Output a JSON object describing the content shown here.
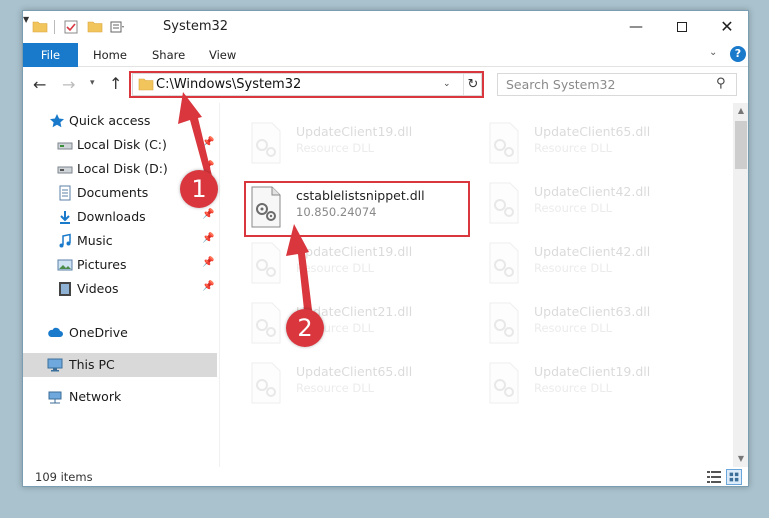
{
  "window": {
    "title": "System32",
    "minimize_label": "—",
    "close_label": "✕"
  },
  "ribbon": {
    "tabs": [
      "File",
      "Home",
      "Share",
      "View"
    ],
    "help_label": "?",
    "collapse_label": "⌄"
  },
  "navigation": {
    "back_glyph": "←",
    "forward_glyph": "→",
    "recent_glyph": "▾",
    "up_glyph": "↑"
  },
  "address": {
    "path": "C:\\Windows\\System32",
    "dropdown_glyph": "⌄",
    "refresh_glyph": "↻"
  },
  "search": {
    "placeholder": "Search System32",
    "icon_glyph": "⚲"
  },
  "nav_pane": {
    "items": [
      {
        "label": "Quick access",
        "icon": "star-icon"
      },
      {
        "label": "Local Disk (C:)",
        "icon": "drive-icon",
        "pinned": true
      },
      {
        "label": "Local Disk (D:)",
        "icon": "drive-icon",
        "pinned": true
      },
      {
        "label": "Documents",
        "icon": "documents-icon",
        "pinned": true
      },
      {
        "label": "Downloads",
        "icon": "downloads-icon",
        "pinned": true
      },
      {
        "label": "Music",
        "icon": "music-icon",
        "pinned": true
      },
      {
        "label": "Pictures",
        "icon": "pictures-icon",
        "pinned": true
      },
      {
        "label": "Videos",
        "icon": "videos-icon",
        "pinned": true
      },
      {
        "label": "OneDrive",
        "icon": "cloud-icon"
      },
      {
        "label": "This PC",
        "icon": "computer-icon",
        "selected": true
      },
      {
        "label": "Network",
        "icon": "network-icon"
      }
    ],
    "pin_glyph": "📌"
  },
  "files": {
    "left": [
      {
        "name": "UpdateClient19.dll",
        "type": "Resource DLL",
        "faded": true
      },
      {
        "name": "cstablelistsnippet.dll",
        "type": "10.850.24074",
        "faded": false
      },
      {
        "name": "UpdateClient19.dll",
        "type": "Resource DLL",
        "faded": true
      },
      {
        "name": "UpdateClient21.dll",
        "type": "Resource DLL",
        "faded": true
      },
      {
        "name": "UpdateClient65.dll",
        "type": "Resource DLL",
        "faded": true
      }
    ],
    "right": [
      {
        "name": "UpdateClient65.dll",
        "type": "Resource DLL",
        "faded": true
      },
      {
        "name": "UpdateClient42.dll",
        "type": "Resource DLL",
        "faded": true
      },
      {
        "name": "UpdateClient42.dll",
        "type": "Resource DLL",
        "faded": true
      },
      {
        "name": "UpdateClient63.dll",
        "type": "Resource DLL",
        "faded": true
      },
      {
        "name": "UpdateClient19.dll",
        "type": "Resource DLL",
        "faded": true
      }
    ]
  },
  "status": {
    "item_count": "109 items"
  },
  "annotations": {
    "step1": "1",
    "step2": "2",
    "color": "#d9363e"
  },
  "colors": {
    "accent": "#1979ca",
    "highlight": "#d9363e",
    "folder": "#f2c55c"
  }
}
